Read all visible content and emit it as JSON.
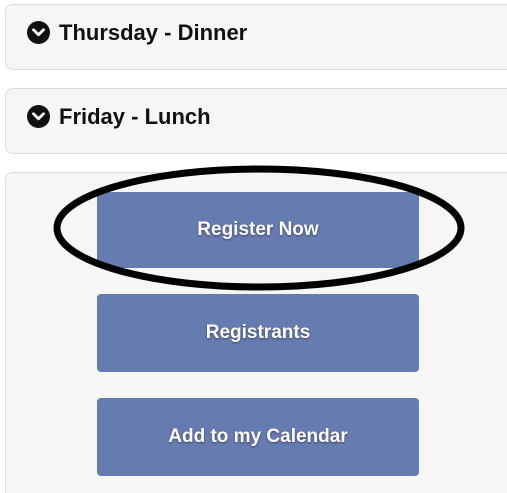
{
  "sections": [
    {
      "title": "Thursday - Dinner",
      "icon": "chevron-down-circle-icon"
    },
    {
      "title": "Friday - Lunch",
      "icon": "chevron-down-circle-icon"
    }
  ],
  "buttons": {
    "register_label": "Register Now",
    "registrants_label": "Registrants",
    "calendar_label": "Add to my Calendar"
  },
  "colors": {
    "button_bg": "#667bb0",
    "panel_bg": "#f6f6f6",
    "annotation": "#000000"
  }
}
